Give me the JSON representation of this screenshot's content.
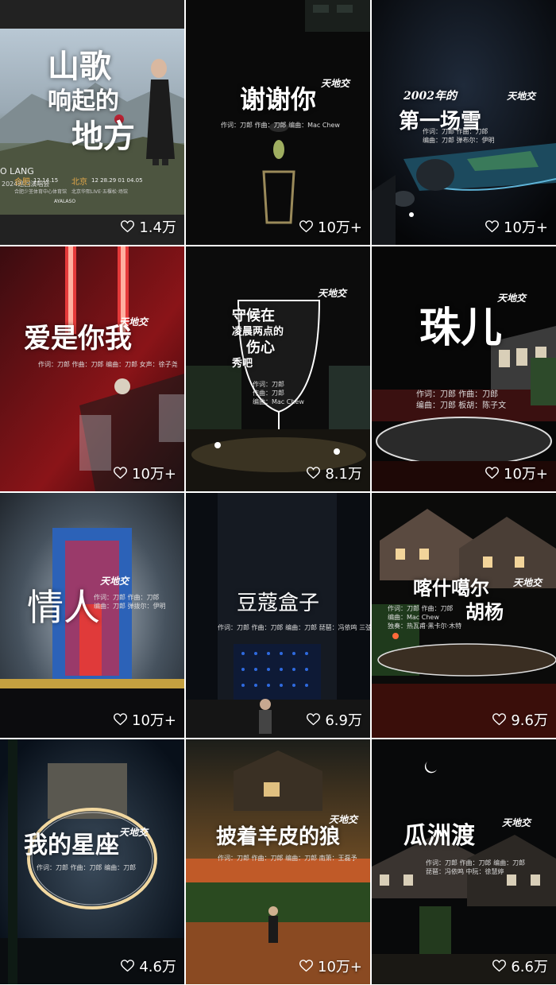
{
  "tiles": [
    {
      "title": "山歌响起的地方",
      "title_lines": [
        "山歌",
        "响起的",
        "地方"
      ],
      "credits": [],
      "likes": "1.4万",
      "poster": {
        "brand": "O LANG",
        "tour": "2024巡回演唱会",
        "city1": "合肥",
        "city1_dates": "12 14.15",
        "city1_venue": "合肥少荃体育中心体育馆",
        "city2": "北京",
        "city2_dates": "12 28.29 01 04.05",
        "city2_venue": "北京华熙LIVE·五棵松·场馆",
        "sponsor": "AYALASO"
      }
    },
    {
      "title": "谢谢你",
      "credits": [
        "作词：刀郎 作曲：刀郎 编曲：Mac Chew"
      ],
      "likes": "10万+",
      "logo": "天地交"
    },
    {
      "title": "第一场雪",
      "title_lines": [
        "2002年的",
        "第一场雪"
      ],
      "credits": [
        "作词：刀郎 作曲：刀郎",
        "编曲：刀郎 弹布尔：伊明"
      ],
      "likes": "10万+",
      "logo": "天地交"
    },
    {
      "title": "爱是你我",
      "credits": [
        "作词：刀郎 作曲：刀郎 编曲：刀郎 女声：徐子尧"
      ],
      "likes": "10万+",
      "logo": "天地交"
    },
    {
      "title": "守候在凌晨两点的伤心秀吧",
      "title_lines": [
        "守候在",
        "凌晨两点的",
        "伤心",
        "秀吧"
      ],
      "credits": [
        "作词：刀郎",
        "作曲：刀郎",
        "编曲：Mac Chew"
      ],
      "likes": "8.1万",
      "logo": "天地交"
    },
    {
      "title": "珠儿",
      "credits": [
        "作词：刀郎 作曲：刀郎",
        "编曲：刀郎 板胡：陈子文"
      ],
      "likes": "10万+",
      "logo": "天地交"
    },
    {
      "title": "情人",
      "credits": [
        "作词：刀郎 作曲：刀郎",
        "编曲：刀郎 弹拨尔：伊明"
      ],
      "likes": "10万+",
      "logo": "天地交"
    },
    {
      "title": "豆蔻盒子",
      "credits": [
        "作词：刀郎 作曲：刀郎 编曲：刀郎 琵琶：冯依鸣 三弦：徐慧婷"
      ],
      "likes": "6.9万"
    },
    {
      "title": "喀什噶尔胡杨",
      "title_lines": [
        "喀什噶尔",
        "胡杨"
      ],
      "credits": [
        "作词：刀郎 作曲：刀郎",
        "编曲：Mac Chew",
        "独奏：热瓦甫·黑卡尔·木特"
      ],
      "likes": "9.6万",
      "logo": "天地交"
    },
    {
      "title": "我的星座",
      "credits": [
        "作词：刀郎 作曲：刀郎 编曲：刀郎"
      ],
      "likes": "4.6万",
      "logo": "天地交"
    },
    {
      "title": "披着羊皮的狼",
      "credits": [
        "作词：刀郎 作曲：刀郎 编曲：刀郎 南箫：王磊予"
      ],
      "likes": "10万+",
      "logo": "天地交"
    },
    {
      "title": "瓜洲渡",
      "credits": [
        "作词：刀郎 作曲：刀郎 编曲：刀郎",
        "琵琶：冯依鸣 中阮：徐慧婷"
      ],
      "likes": "6.6万",
      "logo": "天地交"
    }
  ],
  "icons": {
    "like": "heart-outline-icon"
  },
  "colors": {
    "like_text": "#ffffff",
    "grid_gap": "#ffffff"
  }
}
